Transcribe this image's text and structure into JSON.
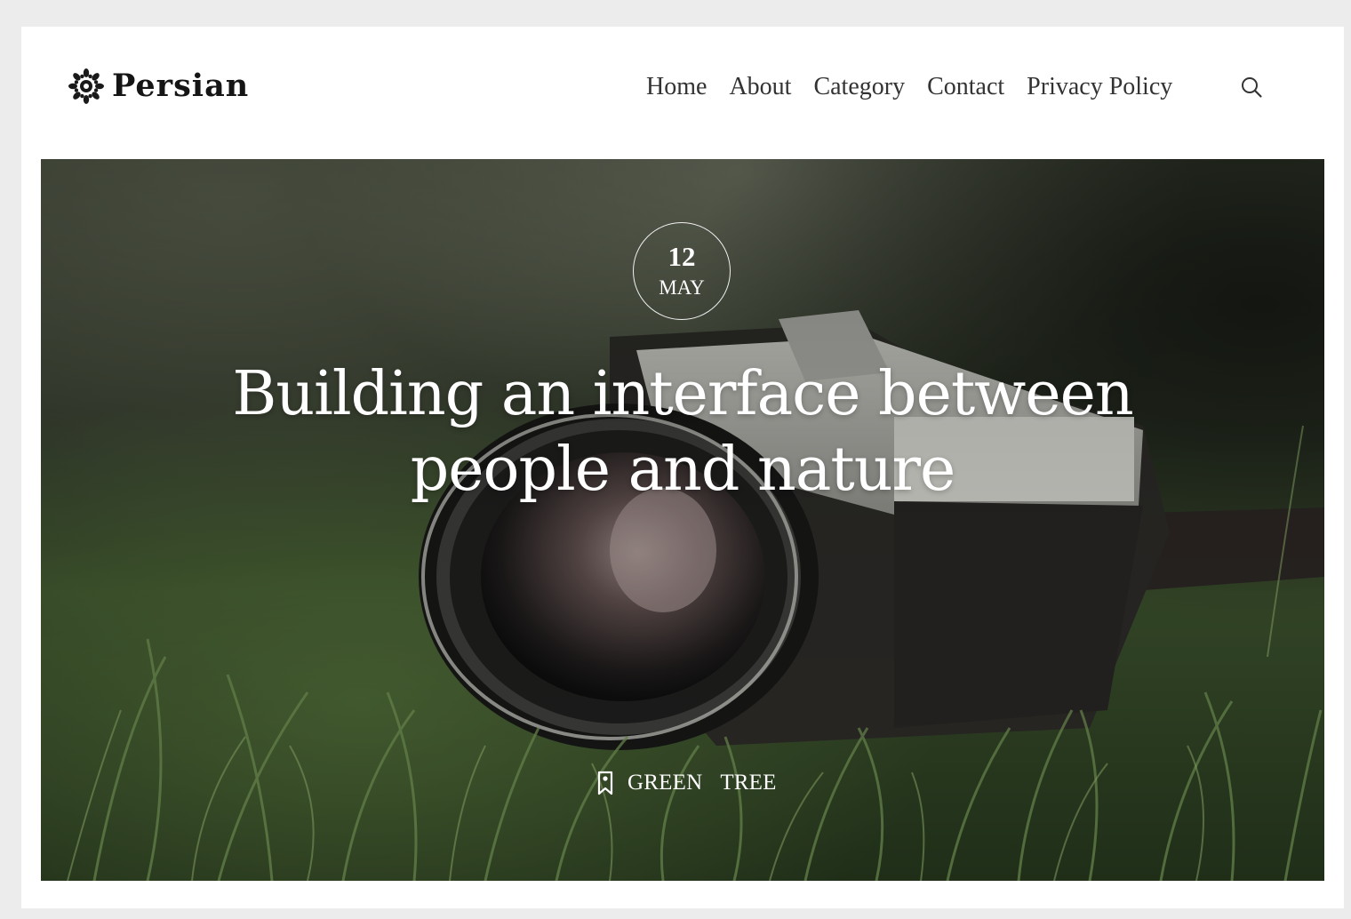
{
  "brand": {
    "name": "Persian",
    "logo_icon": "sunburst-logo-icon"
  },
  "nav": {
    "items": [
      {
        "label": "Home"
      },
      {
        "label": "About"
      },
      {
        "label": "Category"
      },
      {
        "label": "Contact"
      },
      {
        "label": "Privacy Policy"
      }
    ],
    "search_icon": "search-icon"
  },
  "hero": {
    "date": {
      "day": "12",
      "month": "MAY"
    },
    "title": "Building an interface between people and nature",
    "tag_icon": "bookmark-icon",
    "tags": [
      "GREEN",
      "TREE"
    ],
    "background": "camera-in-grass-photo"
  },
  "colors": {
    "page_bg": "#ececec",
    "card_bg": "#ffffff",
    "text_dark": "#333333",
    "hero_text": "#ffffff"
  }
}
